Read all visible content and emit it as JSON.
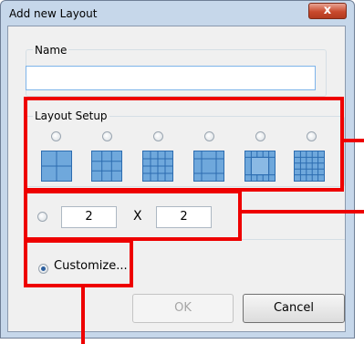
{
  "dialog": {
    "title": "Add new Layout",
    "close_glyph": "x"
  },
  "name_group": {
    "label": "Name",
    "value": ""
  },
  "layout_setup": {
    "label": "Layout Setup",
    "options": [
      {
        "icon": "layout-2x2-icon",
        "selected": false
      },
      {
        "icon": "layout-3x3-icon",
        "selected": false
      },
      {
        "icon": "layout-4x4-icon",
        "selected": false
      },
      {
        "icon": "layout-1-plus-7-icon",
        "selected": false
      },
      {
        "icon": "layout-1-plus-12-icon",
        "selected": false
      },
      {
        "icon": "layout-5x5-icon",
        "selected": false
      }
    ]
  },
  "grid_option": {
    "selected": false,
    "rows": "2",
    "separator": "X",
    "cols": "2"
  },
  "customize_option": {
    "selected": true,
    "label": "Customize..."
  },
  "buttons": {
    "ok_label": "OK",
    "ok_enabled": false,
    "cancel_label": "Cancel"
  },
  "colors": {
    "tile_fill": "#6fa8dc",
    "tile_line": "#2c6cb0",
    "annotation_red": "#ee0000"
  }
}
